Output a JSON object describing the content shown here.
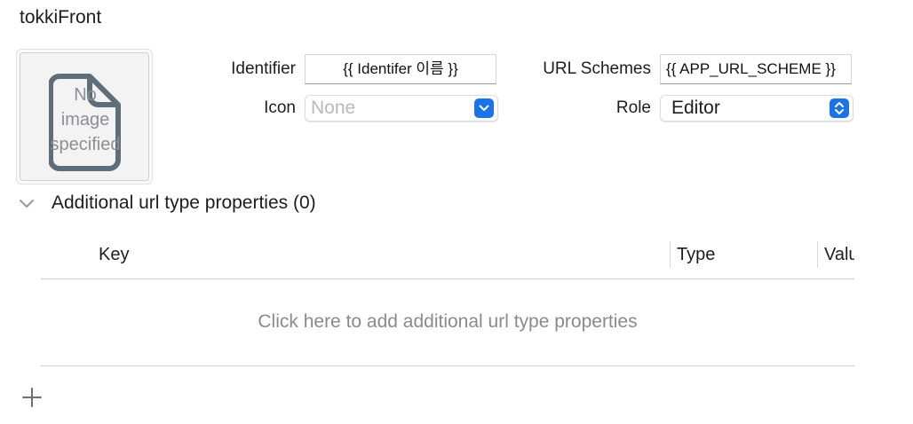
{
  "header": {
    "title": "tokkiFront"
  },
  "image_well": {
    "placeholder_text": "No\nimage\nspecified",
    "icon": "document-icon"
  },
  "form": {
    "identifier_label": "Identifier",
    "identifier_value": "{{ Identifer 이름 }}",
    "icon_label": "Icon",
    "icon_value": "None",
    "url_schemes_label": "URL Schemes",
    "url_schemes_value": "{{ APP_URL_SCHEME }}",
    "role_label": "Role",
    "role_value": "Editor"
  },
  "section": {
    "title": "Additional url type properties (0)",
    "disclosure_icon": "chevron-down-icon"
  },
  "table": {
    "columns": [
      "Key",
      "Type",
      "Value"
    ],
    "empty_text": "Click here to add additional url type properties"
  },
  "footer": {
    "add_icon": "plus-icon"
  },
  "colors": {
    "accent": "#1a74e8",
    "placeholder": "#8a8a8e",
    "separator": "#d0d0d0"
  }
}
